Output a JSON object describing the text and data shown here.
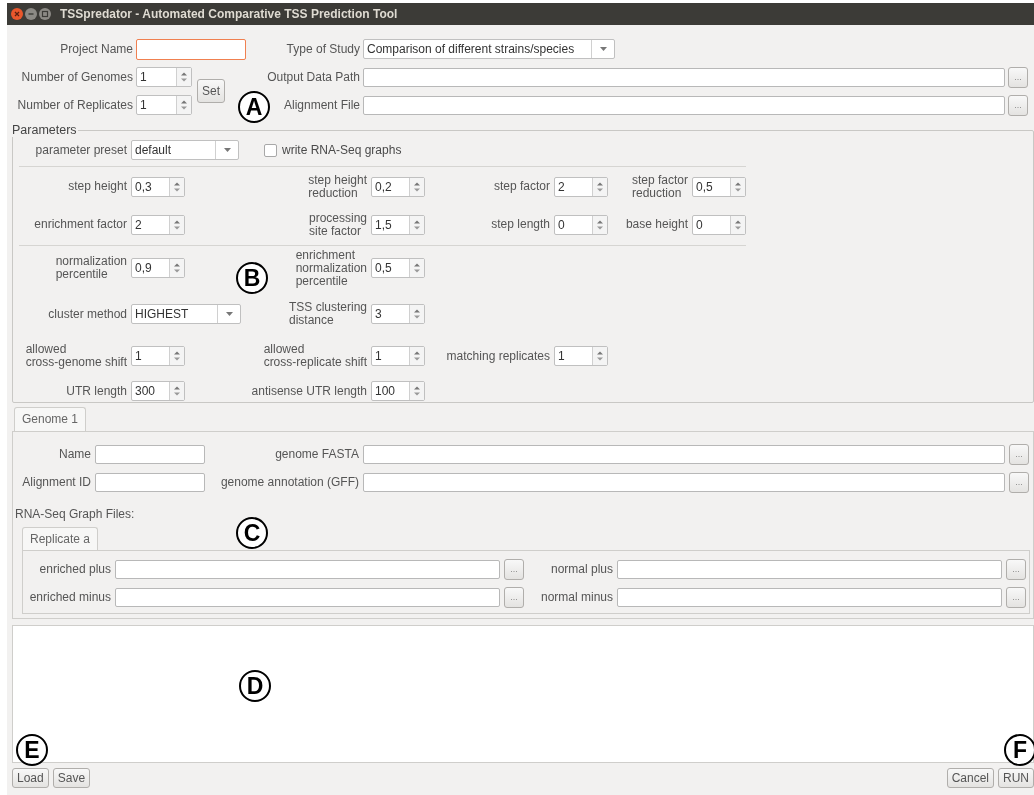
{
  "window": {
    "title": "TSSpredator - Automated Comparative TSS Prediction Tool"
  },
  "project": {
    "project_name": {
      "label": "Project Name",
      "focused": true
    },
    "study_type": {
      "label": "Type of Study",
      "value": "Comparison of different strains/species"
    },
    "genomes": {
      "label": "Number of Genomes",
      "value": "1"
    },
    "replicates": {
      "label": "Number of Replicates",
      "value": "1"
    },
    "set_button": "Set",
    "output_path": {
      "label": "Output Data Path",
      "browse": "..."
    },
    "alignment_file": {
      "label": "Alignment File",
      "browse": "..."
    }
  },
  "parameters": {
    "title": "Parameters",
    "preset": {
      "label": "parameter preset",
      "value": "default"
    },
    "write_graphs": {
      "label": "write RNA-Seq graphs",
      "checked": false
    },
    "groups": [
      [
        [
          {
            "kind": "spinner",
            "label": "step height",
            "value": "0,3"
          },
          {
            "kind": "spinner",
            "label": "step height\nreduction",
            "value": "0,2"
          },
          {
            "kind": "spinner",
            "label": "step factor",
            "value": "2"
          },
          {
            "kind": "spinner",
            "label": "step factor\nreduction",
            "value": "0,5"
          }
        ],
        [
          {
            "kind": "spinner",
            "label": "enrichment factor",
            "value": "2"
          },
          {
            "kind": "spinner",
            "label": "processing\nsite factor",
            "value": "1,5"
          },
          {
            "kind": "spinner",
            "label": "step length",
            "value": "0"
          },
          {
            "kind": "spinner",
            "label": "base height",
            "value": "0"
          }
        ]
      ],
      [
        [
          {
            "kind": "spinner",
            "label": "normalization\npercentile",
            "value": "0,9"
          },
          {
            "kind": "spinner",
            "label": "enrichment\nnormalization\npercentile",
            "value": "0,5"
          }
        ],
        [
          {
            "kind": "combo",
            "label": "cluster method",
            "value": "HIGHEST"
          },
          {
            "kind": "spinner",
            "label": "TSS clustering\ndistance",
            "value": "3"
          }
        ],
        [
          {
            "kind": "spinner",
            "label": "allowed\ncross-genome shift",
            "value": "1"
          },
          {
            "kind": "spinner",
            "label": "allowed\ncross-replicate shift",
            "value": "1"
          },
          {
            "kind": "spinner",
            "label": "matching replicates",
            "value": "1"
          }
        ],
        [
          {
            "kind": "spinner",
            "label": "UTR length",
            "value": "300"
          },
          {
            "kind": "spinner",
            "label": "antisense UTR length",
            "value": "100"
          }
        ]
      ]
    ]
  },
  "genome_section": {
    "tabs": [
      {
        "label": "Genome 1",
        "selected": true
      }
    ],
    "name": {
      "label": "Name"
    },
    "alignment_id": {
      "label": "Alignment ID"
    },
    "fasta": {
      "label": "genome FASTA",
      "browse": "..."
    },
    "annotation": {
      "label": "genome annotation (GFF)",
      "browse": "..."
    },
    "graph_files_label": "RNA-Seq Graph Files:",
    "replicate_tabs": [
      {
        "label": "Replicate a",
        "selected": true
      }
    ],
    "graph_files": [
      {
        "label": "enriched plus",
        "browse": "..."
      },
      {
        "label": "normal plus",
        "browse": "..."
      },
      {
        "label": "enriched minus",
        "browse": "..."
      },
      {
        "label": "normal minus",
        "browse": "..."
      }
    ]
  },
  "buttons_left": [
    "Load",
    "Save"
  ],
  "buttons_right": [
    "Cancel",
    "RUN"
  ],
  "callouts": [
    {
      "label": "A"
    },
    {
      "label": "B"
    },
    {
      "label": "C"
    },
    {
      "label": "D"
    },
    {
      "label": "E"
    },
    {
      "label": "F"
    }
  ]
}
